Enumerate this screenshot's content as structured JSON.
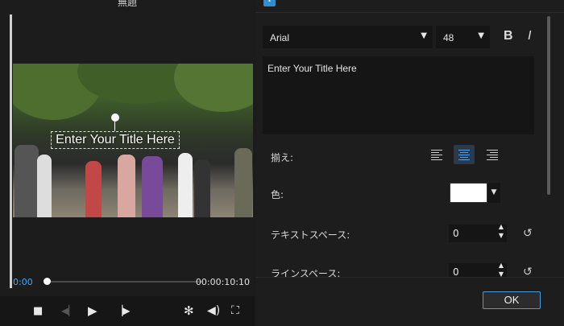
{
  "window": {
    "title": "無題"
  },
  "preview": {
    "overlay_title": "Enter Your Title Here",
    "current_time": "0:00",
    "duration": "00:00:10:10",
    "progress": 0.0
  },
  "controls": {
    "icons": [
      "stop-icon",
      "previous-frame-icon",
      "play-icon",
      "next-frame-icon",
      "settings-icon",
      "volume-icon",
      "fullscreen-icon"
    ]
  },
  "text_panel": {
    "tab_icon": "i",
    "font_family": "Arial",
    "font_size": "48",
    "bold_label": "B",
    "italic_label": "I",
    "text_value": "Enter Your Title Here",
    "align_label": "揃え:",
    "align_selected": "center",
    "color_label": "色:",
    "color_value": "#ffffff",
    "text_spacing_label": "テキストスペース:",
    "text_spacing_value": "0",
    "line_spacing_label": "ラインスペース:",
    "line_spacing_value": "0",
    "ok_label": "OK"
  }
}
